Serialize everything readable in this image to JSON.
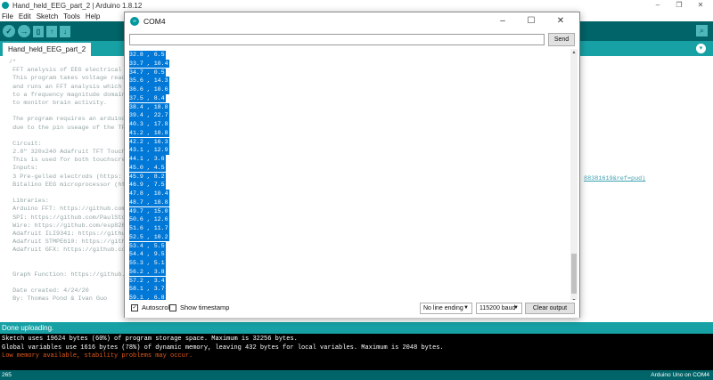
{
  "ide": {
    "title": "Hand_held_EEG_part_2 | Arduino 1.8.12",
    "menu": [
      "File",
      "Edit",
      "Sketch",
      "Tools",
      "Help"
    ],
    "tab": "Hand_held_EEG_part_2",
    "code_lines": [
      "/*",
      " FFT analysis of EEG electrical s",
      " This program takes voltage readi",
      " and runs an FFT analysis which t",
      " to a frequency magnitude domain",
      " to monitor brain activity.",
      "",
      " The program requires an arduino",
      " due to the pin useage of the TFT",
      "",
      " Circuit:",
      " 2.8\" 320x240 Adafruit TFT Touch",
      " This is used for both touchscre",
      " Inputs:",
      " 3 Pre-gelled electrods (https:",
      " Bitalino EEG microprocessor (ht",
      "",
      " Libraries:",
      " Arduino FFT: https://github.com",
      " SPI: https://github.com/PaulSto",
      " Wire: https://github.com/esp826",
      " Adafruit ILI9341: https://github",
      " Adafruit STMPE610: https://githu",
      " Adafruit GFX: https://github.com",
      "",
      "",
      " Graph Function: https://github.c",
      "",
      " Date created: 4/24/20",
      " By: Thomas Pond & Ivan Guo"
    ],
    "code_overflow": "88381619&ref=pud)",
    "status": "Done uploading.",
    "console": [
      "Sketch uses 19624 bytes (60%) of program storage space. Maximum is 32256 bytes.",
      "Global variables use 1616 bytes (78%) of dynamic memory, leaving 432 bytes for local variables. Maximum is 2048 bytes."
    ],
    "console_warning": "Low memory available, stability problems may occur.",
    "line_number": "265",
    "board": "Arduino Uno on COM4"
  },
  "serial": {
    "title": "COM4",
    "send_label": "Send",
    "input_value": "",
    "rows": [
      "32.8 , 6.5",
      "33.7 , 10.4",
      "34.7 , 0.5",
      "35.6 , 14.3",
      "36.6 , 10.6",
      "37.5 , 8.4",
      "38.4 , 18.8",
      "39.4 , 22.7",
      "40.3 , 17.8",
      "41.2 , 10.8",
      "42.2 , 16.3",
      "43.1 , 12.9",
      "44.1 , 3.6",
      "45.0 , 4.5",
      "45.9 , 8.2",
      "46.9 , 7.5",
      "47.8 , 10.4",
      "48.7 , 18.8",
      "49.7 , 15.0",
      "50.6 , 12.6",
      "51.6 , 11.7",
      "52.5 , 10.2",
      "53.4 , 5.5",
      "54.4 , 9.5",
      "55.3 , 5.1",
      "56.2 , 3.8",
      "57.2 , 3.4",
      "58.1 , 3.7",
      "59.1 , 6.8"
    ],
    "autoscroll_label": "Autoscroll",
    "autoscroll_checked": "✓",
    "timestamp_label": "Show timestamp",
    "line_ending": "No line ending",
    "baud": "115200 baud",
    "clear_label": "Clear output"
  }
}
